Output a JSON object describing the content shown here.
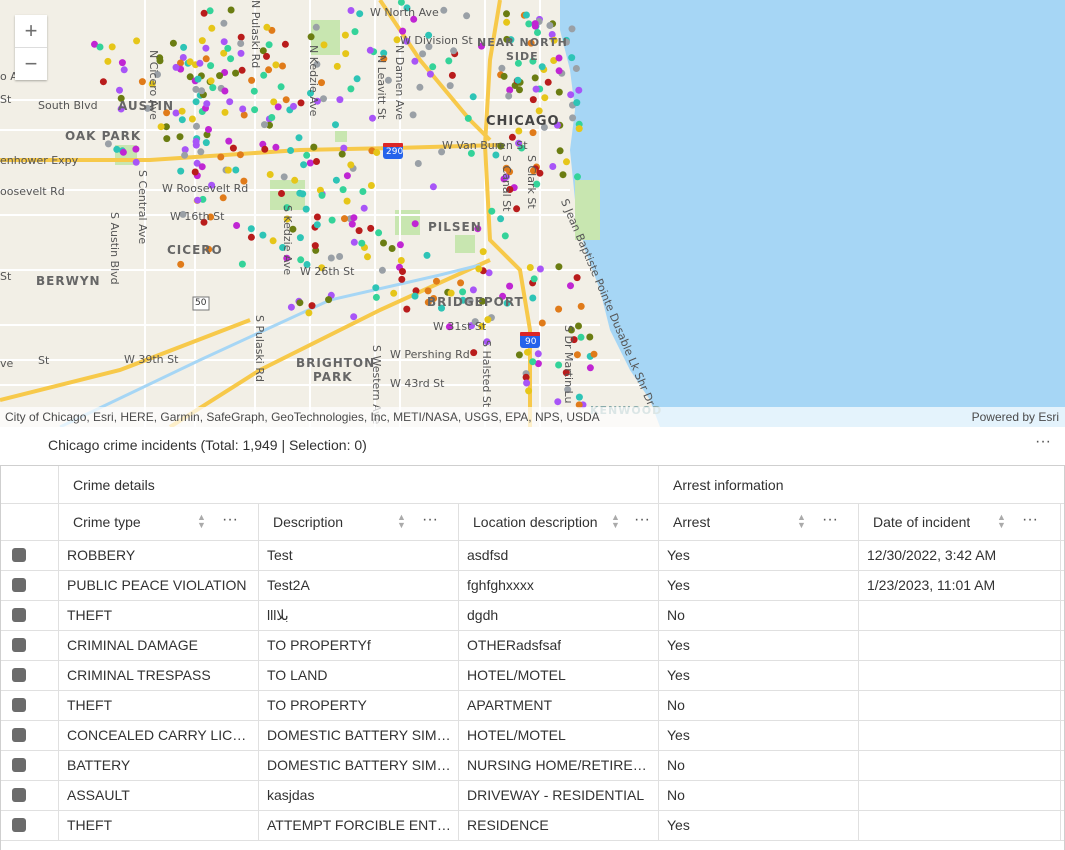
{
  "map": {
    "zoom_in": "+",
    "zoom_out": "−",
    "attribution": "City of Chicago, Esri, HERE, Garmin, SafeGraph, GeoTechnologies, Inc, METI/NASA, USGS, EPA, NPS, USDA",
    "powered_by": "Powered by Esri",
    "labels": {
      "w_north_ave": "W North Ave",
      "w_division_st": "W Division St",
      "near_north_side_1": "NEAR NORTH",
      "near_north_side_2": "SIDE",
      "south_blvd": "South Blvd",
      "austin": "AUSTIN",
      "oak_park": "OAK PARK",
      "chicago": "CHICAGO",
      "eisenhower": "enhower Expy",
      "w_van_buren": "W Van Buren St",
      "roosevelt_left": "oosevelt Rd",
      "w_roosevelt": "W Roosevelt Rd",
      "w_16th": "W 16th St",
      "pilsen": "PILSEN",
      "cicero": "CICERO",
      "berwyn": "BERWYN",
      "w_26th": "W 26th St",
      "bridgeport": "BRIDGEPORT",
      "w_31st": "W 31st St",
      "w_39th": "W 39th St",
      "brighton_1": "BRIGHTON",
      "brighton_2": "PARK",
      "w_pershing": "W Pershing Rd",
      "w_43rd": "W 43rd St",
      "i290": "290",
      "i90": "90",
      "hwy50": "50",
      "n_cicero": "N Cicero Ave",
      "n_pulaski": "N Pulaski Rd",
      "n_kedzie": "N Kedzie Ave",
      "n_leavitt": "N Leavitt St",
      "n_damen": "N Damen Ave",
      "s_central": "S Central Ave",
      "s_austin": "S Austin Blvd",
      "s_pulaski": "S Pulaski Rd",
      "s_kedzie": "S Kedzie Ave",
      "s_western": "S Western Ave",
      "s_halsted": "S Halsted St",
      "s_clark": "S Clark St",
      "s_canal": "S Canal St",
      "s_dr_martin": "S Dr Martin Lu",
      "lake_shore": "S Jean Baptiste Pointe Dusable Lk Shr Dr",
      "kenwood": "KENWOOD",
      "s_st": "St",
      "o_ave": "o Ave",
      "ve": "ve"
    }
  },
  "table": {
    "title": "Chicago crime incidents (Total: 1,949 | Selection: 0)",
    "menu_icon": "···",
    "groups": {
      "crime_details": "Crime details",
      "arrest_information": "Arrest information"
    },
    "columns": [
      "Crime type",
      "Description",
      "Location description",
      "Arrest",
      "Date of incident"
    ],
    "rows": [
      [
        "ROBBERY",
        "Test",
        "asdfsd",
        "Yes",
        "12/30/2022, 3:42 AM"
      ],
      [
        "PUBLIC PEACE VIOLATION",
        "Test2A",
        "fghfghxxxx",
        "Yes",
        "1/23/2023, 11:01 AM"
      ],
      [
        "THEFT",
        "lllبلا",
        "dgdh",
        "No",
        ""
      ],
      [
        "CRIMINAL DAMAGE",
        "TO PROPERTYf",
        "OTHERadsfsaf",
        "Yes",
        ""
      ],
      [
        "CRIMINAL TRESPASS",
        "TO LAND",
        "HOTEL/MOTEL",
        "Yes",
        ""
      ],
      [
        "THEFT",
        "TO PROPERTY",
        "APARTMENT",
        "No",
        ""
      ],
      [
        "CONCEALED CARRY LICENSE VIOLATION",
        "DOMESTIC BATTERY SIMPLE",
        "HOTEL/MOTEL",
        "Yes",
        ""
      ],
      [
        "BATTERY",
        "DOMESTIC BATTERY SIMPLE",
        "NURSING HOME/RETIREMENT HOME",
        "No",
        ""
      ],
      [
        "ASSAULT",
        "kasjdas",
        "DRIVEWAY - RESIDENTIAL",
        "No",
        ""
      ],
      [
        "THEFT",
        "ATTEMPT FORCIBLE ENTRY",
        "RESIDENCE",
        "Yes",
        ""
      ]
    ]
  },
  "colors": {
    "water": "#a6d6f5",
    "land": "#f2efe6",
    "highway": "#f7c94a",
    "park": "#c8e6b0",
    "point_colors": [
      "#2ec4b6",
      "#e6c619",
      "#a855f7",
      "#9aa0a6",
      "#6b7d12",
      "#e07b1a",
      "#b91c1c",
      "#34d399",
      "#c026d3"
    ]
  }
}
